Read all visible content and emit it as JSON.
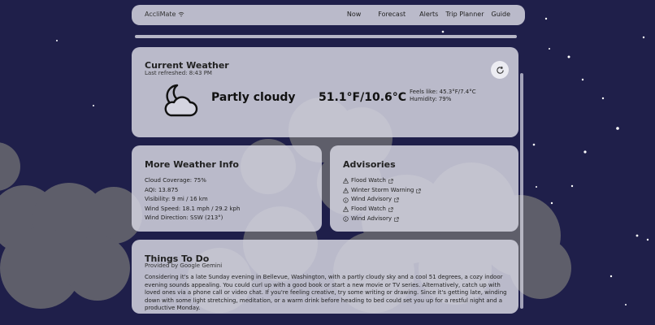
{
  "nav": {
    "brand": "AccliMate",
    "links": [
      "Now",
      "Forecast",
      "Alerts",
      "Trip Planner",
      "Guide"
    ]
  },
  "current": {
    "title": "Current Weather",
    "refreshed": "Last refreshed: 8:43 PM",
    "condition": "Partly cloudy",
    "condition_icon": "partly-cloudy-night-icon",
    "temperature": "51.1°F/10.6°C",
    "feels_like": "Feels like: 45.3°F/7.4°C",
    "humidity": "Humidity: 79%"
  },
  "more": {
    "title": "More Weather Info",
    "items": [
      "Cloud Coverage: 75%",
      "AQI: 13.875",
      "Visibility: 9 mi / 16 km",
      "Wind Speed: 18.1 mph / 29.2 kph",
      "Wind Direction: SSW (213°)"
    ]
  },
  "advisories": {
    "title": "Advisories",
    "items": [
      {
        "label": "Flood Watch",
        "icon": "warning-triangle-icon"
      },
      {
        "label": "Winter Storm Warning",
        "icon": "warning-triangle-icon"
      },
      {
        "label": "Wind Advisory",
        "icon": "info-circle-icon"
      },
      {
        "label": "Flood Watch",
        "icon": "warning-triangle-icon"
      },
      {
        "label": "Wind Advisory",
        "icon": "info-circle-icon"
      }
    ]
  },
  "todo": {
    "title": "Things To Do",
    "subtitle": "Provided by Google Gemini",
    "body": "Considering it's a late Sunday evening in Bellevue, Washington, with a partly cloudy sky and a cool 51 degrees, a cozy indoor evening sounds appealing. You could curl up with a good book or start a new movie or TV series. Alternatively, catch up with loved ones via a phone call or video chat. If you're feeling creative, try some writing or drawing. Since it's getting late, winding down with some light stretching, meditation, or a warm drink before heading to bed could set you up for a restful night and a productive Monday."
  },
  "colors": {
    "background": "#1f1f4a",
    "panel": "#d4d4e0",
    "cloud": "#5a5a66"
  }
}
